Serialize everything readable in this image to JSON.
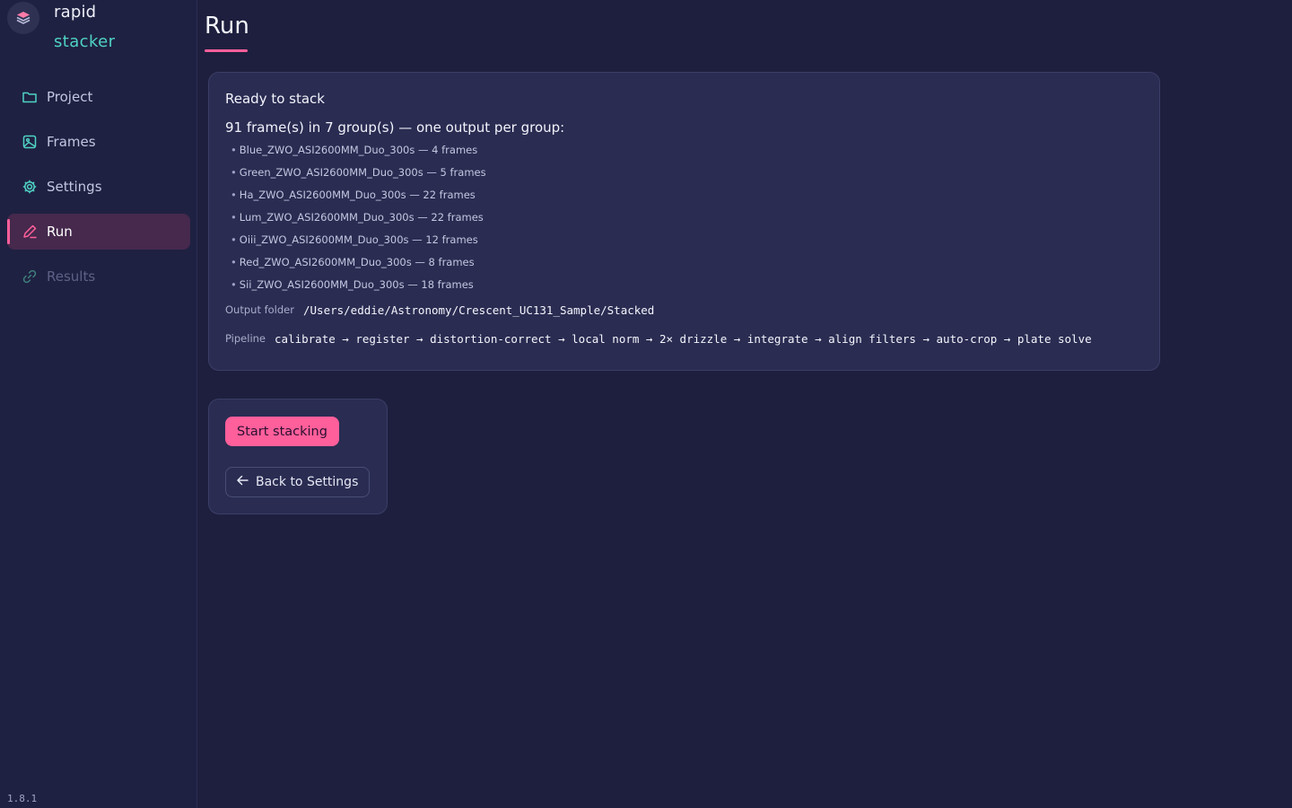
{
  "brand": {
    "word1": "rapid",
    "word2": "stacker"
  },
  "sidebar": {
    "items": [
      {
        "label": "Project",
        "icon": "folder-icon",
        "state": "normal"
      },
      {
        "label": "Frames",
        "icon": "image-icon",
        "state": "normal"
      },
      {
        "label": "Settings",
        "icon": "gear-icon",
        "state": "normal"
      },
      {
        "label": "Run",
        "icon": "pencil-icon",
        "state": "active"
      },
      {
        "label": "Results",
        "icon": "link-icon",
        "state": "disabled"
      }
    ],
    "version": "1.8.1"
  },
  "page": {
    "title": "Run"
  },
  "summary": {
    "heading": "Ready to stack",
    "groups_heading": "91 frame(s) in 7 group(s) — one output per group:",
    "groups": [
      "Blue_ZWO_ASI2600MM_Duo_300s — 4 frames",
      "Green_ZWO_ASI2600MM_Duo_300s — 5 frames",
      "Ha_ZWO_ASI2600MM_Duo_300s — 22 frames",
      "Lum_ZWO_ASI2600MM_Duo_300s — 22 frames",
      "Oiii_ZWO_ASI2600MM_Duo_300s — 12 frames",
      "Red_ZWO_ASI2600MM_Duo_300s — 8 frames",
      "Sii_ZWO_ASI2600MM_Duo_300s — 18 frames"
    ],
    "output_label": "Output folder",
    "output_value": "/Users/eddie/Astronomy/Crescent_UC131_Sample/Stacked",
    "pipeline_label": "Pipeline",
    "pipeline_value": "calibrate → register → distortion-correct → local norm → 2× drizzle → integrate → align filters → auto-crop → plate solve"
  },
  "actions": {
    "start_label": "Start stacking",
    "back_label": "Back to Settings"
  },
  "colors": {
    "accent": "#ff5f9a",
    "brand_teal": "#4fd3c4",
    "background": "#1e1f3e",
    "card": "#2a2c52"
  }
}
